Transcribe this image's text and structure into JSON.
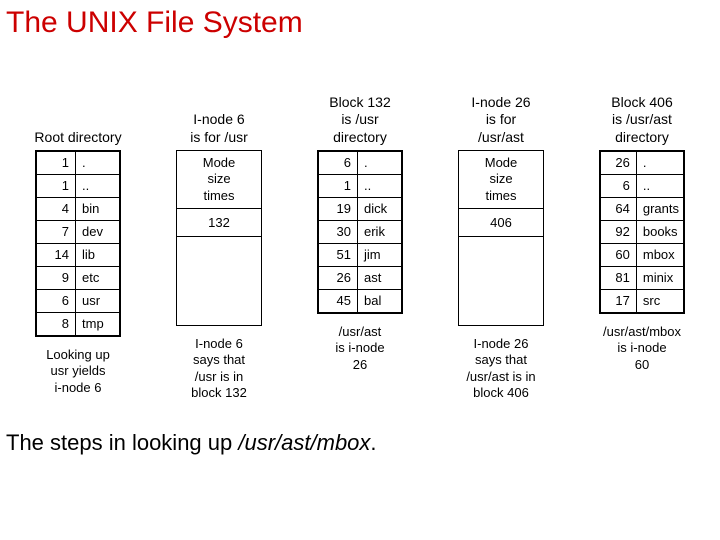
{
  "title": "The UNIX File System",
  "caption_prefix": "The steps in looking up ",
  "caption_path": "/usr/ast/mbox",
  "caption_suffix": ".",
  "columns": [
    {
      "header": "Root directory",
      "type": "dir",
      "rows": [
        {
          "num": "1",
          "name": "."
        },
        {
          "num": "1",
          "name": ".."
        },
        {
          "num": "4",
          "name": "bin"
        },
        {
          "num": "7",
          "name": "dev"
        },
        {
          "num": "14",
          "name": "lib"
        },
        {
          "num": "9",
          "name": "etc"
        },
        {
          "num": "6",
          "name": "usr"
        },
        {
          "num": "8",
          "name": "tmp"
        }
      ],
      "footer": "Looking up\nusr yields\ni-node 6"
    },
    {
      "header": "I-node 6\nis for /usr",
      "type": "inode",
      "top": "Mode\nsize\ntimes",
      "mid": "132",
      "footer": "I-node 6\nsays that\n/usr is in\nblock 132"
    },
    {
      "header": "Block 132\nis /usr\ndirectory",
      "type": "dir",
      "rows": [
        {
          "num": "6",
          "name": "."
        },
        {
          "num": "1",
          "name": ".."
        },
        {
          "num": "19",
          "name": "dick"
        },
        {
          "num": "30",
          "name": "erik"
        },
        {
          "num": "51",
          "name": "jim"
        },
        {
          "num": "26",
          "name": "ast"
        },
        {
          "num": "45",
          "name": "bal"
        }
      ],
      "footer": "/usr/ast\nis i-node\n26"
    },
    {
      "header": "I-node 26\nis for\n/usr/ast",
      "type": "inode",
      "top": "Mode\nsize\ntimes",
      "mid": "406",
      "footer": "I-node 26\nsays that\n/usr/ast is in\nblock 406"
    },
    {
      "header": "Block 406\nis /usr/ast\ndirectory",
      "type": "dir",
      "rows": [
        {
          "num": "26",
          "name": "."
        },
        {
          "num": "6",
          "name": ".."
        },
        {
          "num": "64",
          "name": "grants"
        },
        {
          "num": "92",
          "name": "books"
        },
        {
          "num": "60",
          "name": "mbox"
        },
        {
          "num": "81",
          "name": "minix"
        },
        {
          "num": "17",
          "name": "src"
        }
      ],
      "footer": "/usr/ast/mbox\nis i-node\n60"
    }
  ]
}
